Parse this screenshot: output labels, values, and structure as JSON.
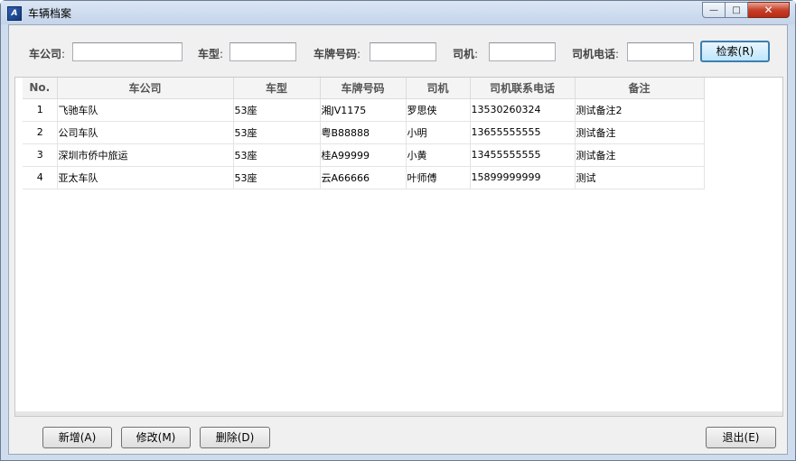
{
  "window": {
    "title": "车辆档案",
    "icon": "app-icon",
    "caption": {
      "minimize": "—",
      "maximize": "□",
      "close": "✕"
    }
  },
  "search": {
    "company_label": "车公司",
    "company_value": "",
    "type_label": "车型",
    "type_value": "",
    "plate_label": "车牌号码",
    "plate_value": "",
    "driver_label": "司机",
    "driver_value": "",
    "phone_label": "司机电话",
    "phone_value": "",
    "colon": ":",
    "search_button": "检索(R)"
  },
  "table": {
    "headers": [
      "No.",
      "车公司",
      "车型",
      "车牌号码",
      "司机",
      "司机联系电话",
      "备注"
    ],
    "rows": [
      [
        "1",
        "飞驰车队",
        "53座",
        "湘JV1175",
        "罗思侠",
        "13530260324",
        "测试备注2"
      ],
      [
        "2",
        "公司车队",
        "53座",
        "粤B88888",
        "小明",
        "13655555555",
        "测试备注"
      ],
      [
        "3",
        "深圳市侨中旅运",
        "53座",
        "桂A99999",
        "小黄",
        "13455555555",
        "测试备注"
      ],
      [
        "4",
        "亚太车队",
        "53座",
        "云A66666",
        "叶师傅",
        "15899999999",
        "测试"
      ]
    ]
  },
  "actions": {
    "add": "新增(A)",
    "edit": "修改(M)",
    "delete": "删除(D)",
    "exit": "退出(E)"
  },
  "colors": {
    "titlebar": "#c4d4ea",
    "client": "#f0f0f0",
    "close_button": "#c7402a",
    "focus_border": "#3c7fb1"
  }
}
